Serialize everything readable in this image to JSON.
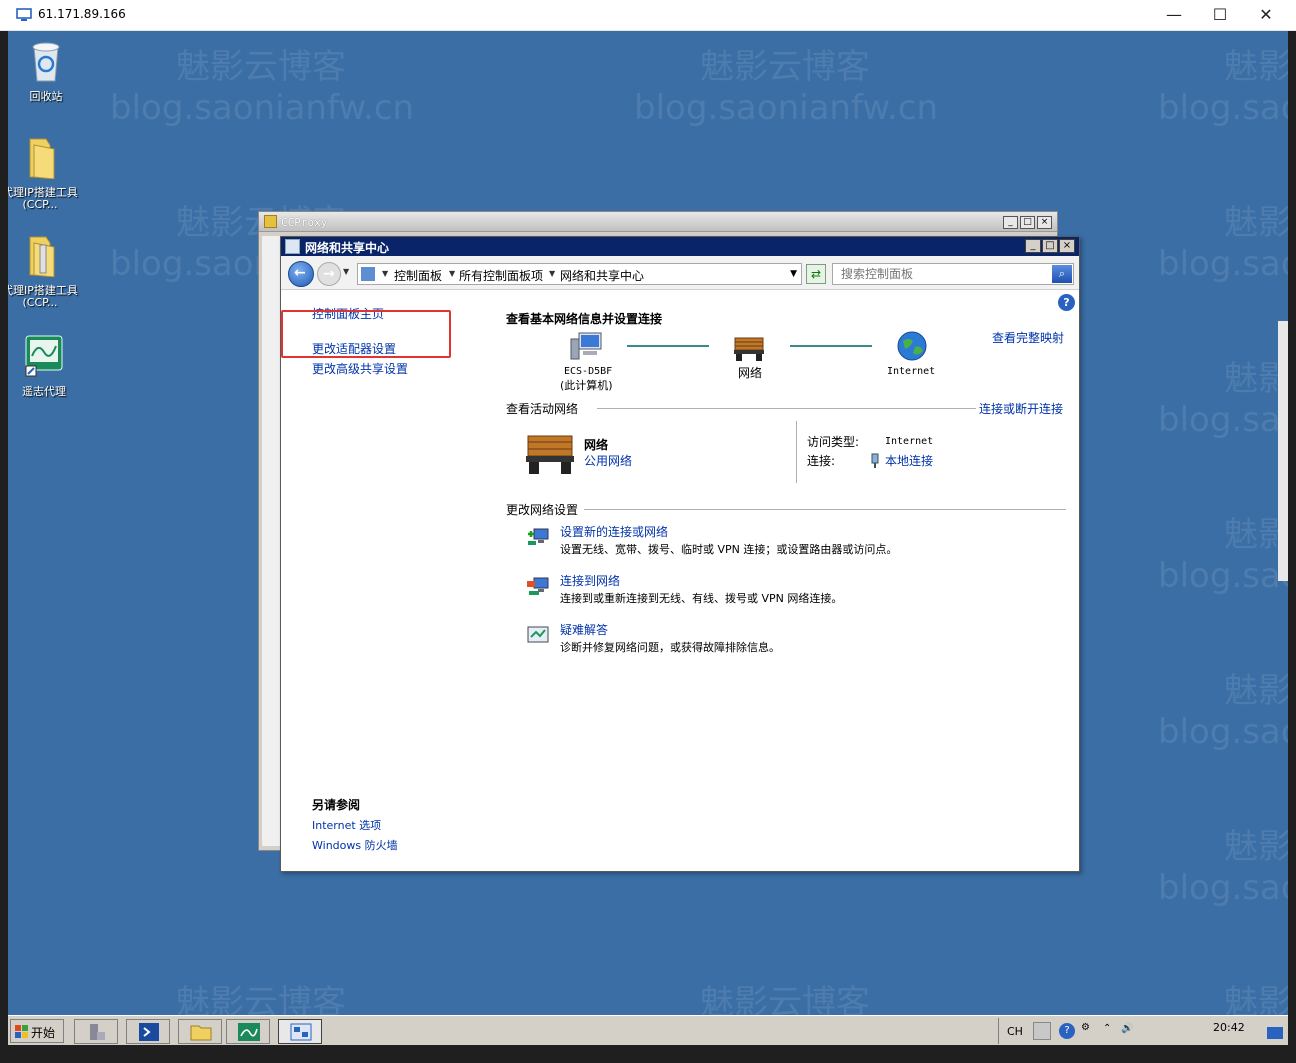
{
  "rdp": {
    "title": "61.171.89.166",
    "minimize": "—",
    "maximize": "☐",
    "close": "✕"
  },
  "watermark": {
    "line1": "魅影云博客",
    "line2": "blog.saonianfw.cn"
  },
  "desktop_icons": [
    {
      "label": "回收站",
      "icon": "recycle-bin-icon"
    },
    {
      "label": "代理IP搭建工具(CCP...",
      "icon": "folder-icon"
    },
    {
      "label": "代理IP搭建工具(CCP...",
      "icon": "folder-icon"
    },
    {
      "label": "遥志代理",
      "icon": "proxy-app-icon"
    }
  ],
  "ccproxy": {
    "title": "CCProxy"
  },
  "window": {
    "title": "网络和共享中心",
    "breadcrumbs": [
      "控制面板",
      "所有控制面板项",
      "网络和共享中心"
    ],
    "search_placeholder": "搜索控制面板"
  },
  "left_pane": {
    "home_link": "控制面板主页",
    "adapter_link": "更改适配器设置",
    "advanced_link": "更改高级共享设置",
    "see_also_heading": "另请参阅",
    "see_also": [
      "Internet 选项",
      "Windows 防火墙"
    ]
  },
  "main": {
    "heading": "查看基本网络信息并设置连接",
    "full_map_link": "查看完整映射",
    "map": {
      "computer_name": "ECS-D5BF",
      "computer_sub": "(此计算机)",
      "network": "网络",
      "internet": "Internet"
    },
    "active_section": {
      "label": "查看活动网络",
      "connect_link": "连接或断开连接",
      "network_name": "网络",
      "network_type": "公用网络",
      "access_type_label": "访问类型:",
      "access_type_value": "Internet",
      "connection_label": "连接:",
      "connection_value": "本地连接"
    },
    "change_section": {
      "label": "更改网络设置",
      "tasks": [
        {
          "title": "设置新的连接或网络",
          "desc": "设置无线、宽带、拨号、临时或 VPN 连接；或设置路由器或访问点。"
        },
        {
          "title": "连接到网络",
          "desc": "连接到或重新连接到无线、有线、拨号或 VPN 网络连接。"
        },
        {
          "title": "疑难解答",
          "desc": "诊断并修复网络问题，或获得故障排除信息。"
        }
      ]
    }
  },
  "taskbar": {
    "start_label": "开始",
    "lang": "CH",
    "time": "20:42"
  },
  "colors": {
    "desktop": "#3a6ea5",
    "link": "#0033aa",
    "titlebar": "#0a246a",
    "highlight": "#e23232"
  }
}
